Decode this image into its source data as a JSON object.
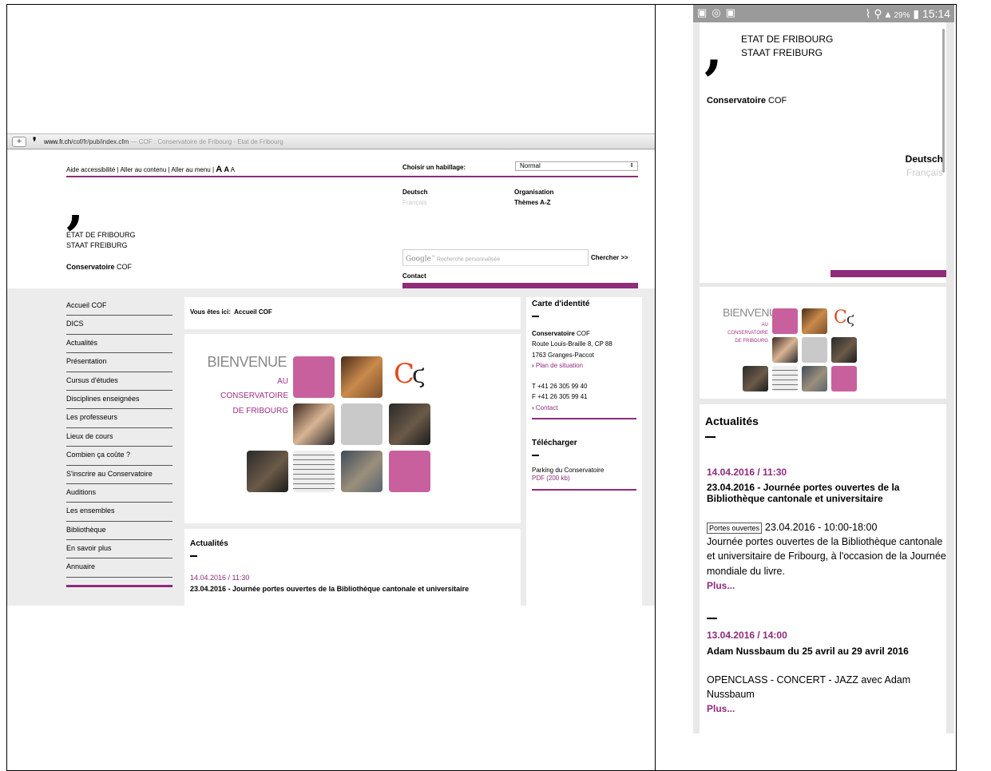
{
  "desktop": {
    "url_domain": "www.fr.ch",
    "url_path": "/cof/fr/pub/index.cfm",
    "page_title": " — COF : Conservatoire de Fribourg - Etat de Fribourg",
    "accessibility": {
      "aide": "Aide accessibilité",
      "sep1": " | ",
      "contenu": "Aller au contenu",
      "sep2": " | ",
      "menu": "Aller au menu",
      "sep3": " | ",
      "a1": "A",
      "a2": "A",
      "a3": "A"
    },
    "skin_label": "Choisir un habillage:",
    "skin_value": "Normal",
    "etat_line1": "ETAT DE FRIBOURG",
    "etat_line2": "STAAT FREIBURG",
    "conserv_bold": "Conservatoire",
    "conserv_rest": " COF",
    "lang_de": "Deutsch",
    "lang_fr": "Français",
    "org": "Organisation",
    "themes": "Thèmes A-Z",
    "search_placeholder": "Recherche personnalisée",
    "search_brand": "Google",
    "search_button": "Chercher >>",
    "contact": "Contact",
    "nav": [
      "Accueil COF",
      "DICS",
      "Actualités",
      "Présentation",
      "Cursus d'études",
      "Disciplines enseignées",
      "Les professeurs",
      "Lieux de cours",
      "Combien ça coûte ?",
      "S'inscrire au Conservatoire",
      "Auditions",
      "Les ensembles",
      "Bibliothèque",
      "En savoir plus",
      "Annuaire"
    ],
    "breadcrumb_label": "Vous êtes ici:",
    "breadcrumb_value": "Accueil COF",
    "welcome": {
      "title": "BIENVENUE",
      "l1": "AU",
      "l2": "CONSERVATOIRE",
      "l3": "DE FRIBOURG"
    },
    "news_heading": "Actualités",
    "news_date": "14.04.2016 / 11:30",
    "news_title": "23.04.2016 - Journée portes ouvertes de la Bibliothèque cantonale et universitaire",
    "card": {
      "heading": "Carte d'identité",
      "name_bold": "Conservatoire",
      "name_rest": " COF",
      "address1": "Route Louis-Braille 8, CP 88",
      "address2": "1763 Granges-Paccot",
      "plan": "Plan de situation",
      "tel": "T +41 26 305 99 40",
      "fax": "F +41 26 305 99 41",
      "contact": "Contact"
    },
    "download": {
      "heading": "Télécharger",
      "item": "Parking du Conservatoire",
      "file": "PDF (200 kb)"
    }
  },
  "mobile": {
    "status_battery": "29%",
    "status_time": "15:14",
    "etat_line1": "ETAT DE FRIBOURG",
    "etat_line2": "STAAT FREIBURG",
    "conserv_bold": "Conservatoire",
    "conserv_rest": " COF",
    "lang_de": "Deutsch",
    "lang_fr": "Français",
    "welcome": {
      "title": "BIENVENUE",
      "l1": "AU",
      "l2": "CONSERVATOIRE",
      "l3": "DE FRIBOURG"
    },
    "news_heading": "Actualités",
    "news": [
      {
        "date": "14.04.2016 / 11:30",
        "title": "23.04.2016 - Journée portes ouvertes de la Bibliothèque cantonale et universitaire",
        "tag": "Portes ouvertes",
        "lead": "23.04.2016 - 10:00-18:00",
        "body": "Journée portes ouvertes de la Bibliothèque cantonale et universitaire de Fribourg, à l'occasion de la Journée mondiale du livre.",
        "more": "Plus..."
      },
      {
        "date": "13.04.2016 / 14:00",
        "title": "Adam Nussbaum du 25 avril au 29 avril 2016",
        "body": "OPENCLASS - CONCERT - JAZZ avec Adam Nussbaum",
        "more": "Plus..."
      }
    ]
  },
  "colors": {
    "accent": "#8e2b7b",
    "tile_pink": "#c9609e",
    "tile_grey": "#c9c9c9"
  }
}
